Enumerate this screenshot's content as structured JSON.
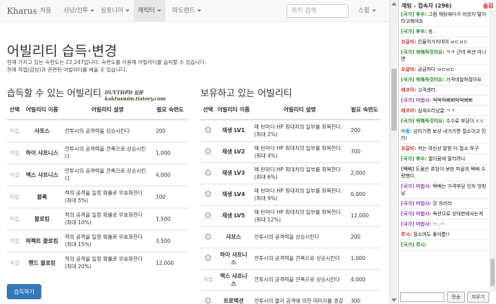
{
  "nav": {
    "brand": "Kharus",
    "items": [
      {
        "label": "처음",
        "dropdown": false,
        "active": false
      },
      {
        "label": "사냥/전투",
        "dropdown": true,
        "active": false
      },
      {
        "label": "심포니아",
        "dropdown": true,
        "active": false
      },
      {
        "label": "캐릭터",
        "dropdown": true,
        "active": true
      },
      {
        "label": "마도랜드",
        "dropdown": true,
        "active": false
      }
    ],
    "search_placeholder": "위키 검색",
    "user_menu": "스윙"
  },
  "page": {
    "title": "어빌리티 습득·변경",
    "info_lines": [
      "현재 가지고 있는 숙련도는 22,247입니다. 숙련도를 이용해 어빌리티를 습득할 수 있습니다.",
      "현재 직업(검성)과 관련된 어빌리티를 배울 수 있습니다."
    ],
    "learnable_title": "습득할 수 있는 어빌리티",
    "owned_title": "보유하고 있는 어빌리티",
    "watermark": [
      "DUYTHPD 입문",
      "kaktuswim.tistory.com"
    ],
    "learn_button": "습득하기"
  },
  "learnable": {
    "headers": [
      "선택",
      "어빌리티 이름",
      "어빌리티 설명",
      "필요 숙련도"
    ],
    "rows": [
      {
        "sel": "직업",
        "name": "샤프스",
        "desc": "전투시의 공격력을 상승시킨다",
        "pts": "200"
      },
      {
        "sel": "직업",
        "name": "하이 샤프니스",
        "desc": "전투시의 공격력을 큰폭으로 상승시킨다",
        "pts": "1,000"
      },
      {
        "sel": "직업",
        "name": "맥스 샤프니스",
        "desc": "전투시의 공격력을 큰폭으로 상승시킨다",
        "pts": "4,000"
      },
      {
        "sel": "직업",
        "name": "블록",
        "desc": "적의 공격을 일정 확률로 무효화한다 (최대 5%)",
        "pts": "100"
      },
      {
        "sel": "직업",
        "name": "블로킹",
        "desc": "적의 공격을 일정 확률로 무효화한다 (최대 10%)",
        "pts": "1,500"
      },
      {
        "sel": "직업",
        "name": "퍼펙트 블로킹",
        "desc": "적의 공격을 일정 확률로 무효화한다 (최대 15%)",
        "pts": "3,500"
      },
      {
        "sel": "직업",
        "name": "핸드 블로킹",
        "desc": "적의 공격을 일정 확률로 무효화한다 (최대 20%)",
        "pts": "12,000"
      }
    ]
  },
  "owned": {
    "headers": [
      "선택",
      "어빌리티 이름",
      "어빌리티 설명",
      "필요 숙련도"
    ],
    "rows": [
      {
        "sel": "radio",
        "name": "재생 LV1",
        "desc": "매 턴마다 HP 최대치의 일부를 회복한다. (최대 2%)",
        "pts": "200"
      },
      {
        "sel": "radio",
        "name": "재생 LV2",
        "desc": "매 턴마다 HP 최대치의 일부를 회복한다. (최대 4%)",
        "pts": "700"
      },
      {
        "sel": "radio",
        "name": "재생 LV3",
        "desc": "매 턴마다 HP 최대치의 일부를 회복한다. (최대 6%)",
        "pts": "2,000"
      },
      {
        "sel": "radio",
        "name": "재생 LV4",
        "desc": "매 턴마다 HP 최대치의 일부를 회복한다. (최대 9%)",
        "pts": "6,000"
      },
      {
        "sel": "radio",
        "name": "재생 LV5",
        "desc": "매 턴마다 HP 최대치의 일부를 회복한다. (최대 12%)",
        "pts": "12,000"
      },
      {
        "sel": "radio",
        "name": "샤프스",
        "desc": "전투시의 공격력을 상승시킨다",
        "pts": "200"
      },
      {
        "sel": "radio",
        "name": "하이 샤프니스",
        "desc": "전투시의 공격력을 큰폭으로 상승시킨다",
        "pts": "1,000"
      },
      {
        "sel": "직업",
        "name": "맥스 샤프니스",
        "desc": "전투시의 공격력을 큰폭으로 상승시킨다",
        "pts": "4,000"
      },
      {
        "sel": "radio",
        "name": "프로텍션",
        "desc": "전투시의 물리 공격에 의한 데미지를 경감",
        "pts": "300"
      }
    ]
  },
  "chat": {
    "header": "채팅 - 접속자 (296)",
    "hide": "숨김",
    "messages": [
      {
        "who": "[국가] 후우:",
        "text": "그럼 채팅에다가 쉬었지 말이라고해야죠",
        "color": "#2a8a2a"
      },
      {
        "who": "[국가] 후우:",
        "text": "응.",
        "color": "#2a8a2a"
      },
      {
        "who": "꼬갈비:",
        "text": "인들어가지네여 ㅂㄷㅂㄷ",
        "color": "#c0392b"
      },
      {
        "who": "[국가] 워해즉것어요:",
        "text": "ㅋㅋ 근데 옥션 아니면",
        "color": "#2a8a2a"
      },
      {
        "who": "꼬갈비:",
        "text": "궁금하다 ㅂㄷㅂㄷ",
        "color": "#c0392b"
      },
      {
        "who": "[국가] 워해즉것어요:",
        "text": "가격네칠하잖아요",
        "color": "#2a8a2a"
      },
      {
        "who": "에코아:",
        "text": "고객센터",
        "color": "#c0392b"
      },
      {
        "who": "[국가] 마법사:",
        "text": "떡떡떡뻐뻐떡떡뻐뻐",
        "color": "#8e44ad"
      },
      {
        "who": "에코아:",
        "text": "심새소리났글 ㄱㄱ",
        "color": "#c0392b"
      },
      {
        "who": "[국가] 워해즉것어요:",
        "text": "수수료 부담이 ㄷㄷ",
        "color": "#2a8a2a"
      },
      {
        "who": "마동:",
        "text": "넘이기면 보상 내가가면 절소이고 진리!",
        "color": "#2980b9"
      },
      {
        "who": "꼬갈비:",
        "text": "저는 여신상 밭받 다 절소 하구",
        "color": "#c0392b"
      },
      {
        "who": "[국가] 후우:",
        "text": "엘이꿈에 말리려나",
        "color": "#2a8a2a"
      },
      {
        "who": "[택배]",
        "text": "도움은 흐임이 보받 마을의 택배 수령했다.",
        "color": "#555555"
      },
      {
        "who": "[국가] 마법사:",
        "text": "택배는 가격부담 인자 엉청남",
        "color": "#8e44ad"
      },
      {
        "who": "[국가] 마법사:",
        "text": "강 차라리",
        "color": "#8e44ad"
      },
      {
        "who": "[국가] 마법사:",
        "text": "옥션으로 상대한테사는게",
        "color": "#8e44ad"
      },
      {
        "who": "[국가] 마법사:",
        "text": "ㅡ..ㅡ",
        "color": "#8e44ad"
      },
      {
        "who": "루시:",
        "text": "잠소여도 좋아름!!",
        "color": "#c0392b"
      },
      {
        "who": "[국가] 루시:",
        "text": "",
        "color": "#2a8a2a"
      }
    ],
    "input_placeholder": "",
    "send_label": "전송",
    "clear_label": "지우기"
  }
}
